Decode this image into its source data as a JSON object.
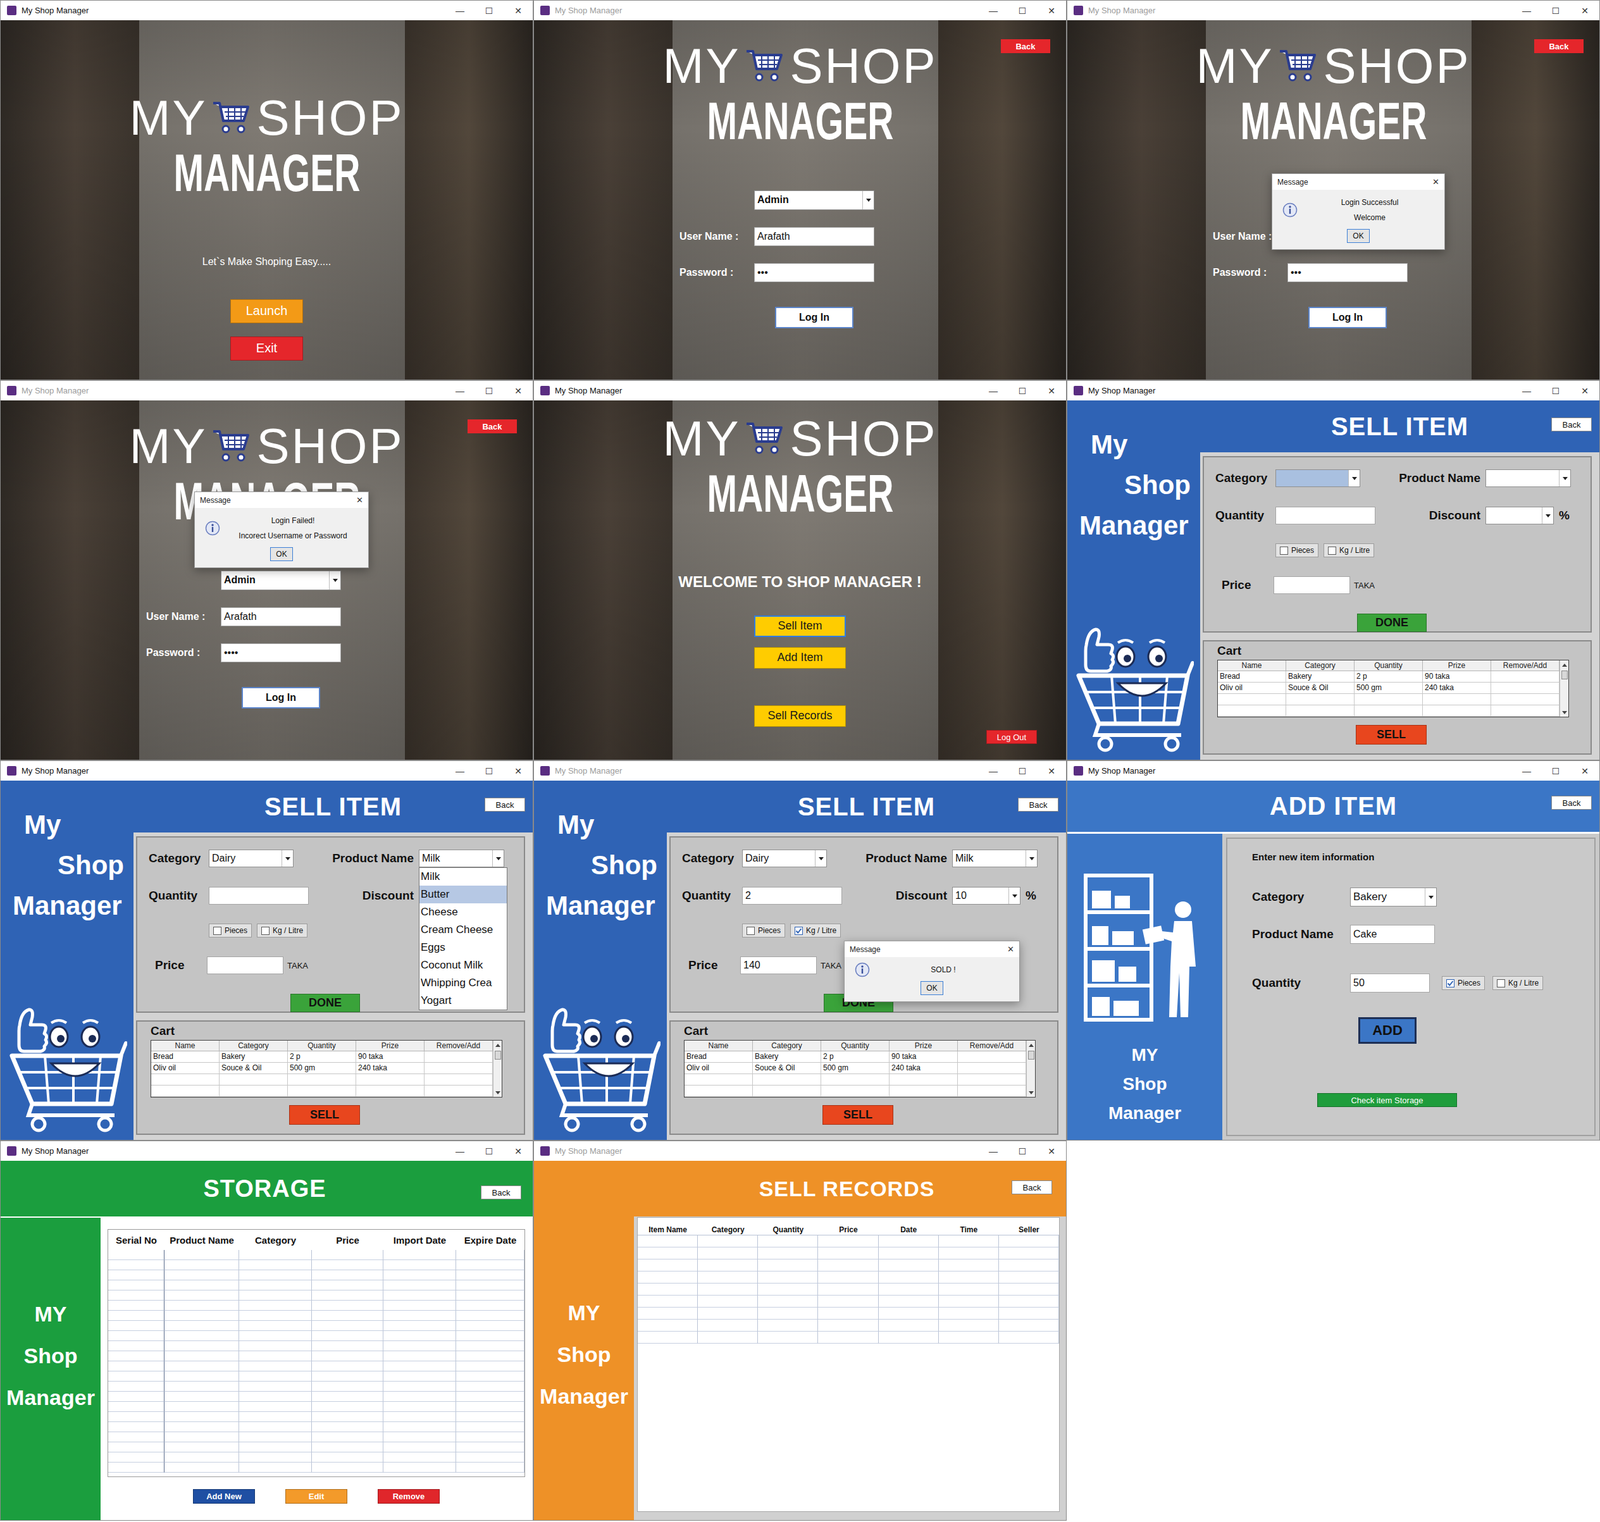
{
  "app_title": "My Shop Manager",
  "window_controls": [
    "—",
    "☐",
    "✕"
  ],
  "logo": {
    "my": "MY",
    "shop": "SHOP",
    "manager": "MANAGER"
  },
  "windows": [
    {
      "kind": "splash",
      "active": true,
      "tagline": "Let`s Make Shoping Easy.....",
      "buttons": [
        {
          "label": "Launch",
          "color": "#f39a16"
        },
        {
          "label": "Exit",
          "color": "#e5262b"
        }
      ]
    },
    {
      "kind": "login",
      "active": false,
      "back": "Back",
      "role": "Admin",
      "fields": [
        {
          "label": "User Name :",
          "value": "Arafath"
        },
        {
          "label": "Password :",
          "value": "•••"
        }
      ],
      "submit": "Log In"
    },
    {
      "kind": "login",
      "active": false,
      "back": "Back",
      "role": "Admin",
      "fields": [
        {
          "label": "User Name :",
          "value": "Arafath"
        },
        {
          "label": "Password :",
          "value": "•••"
        }
      ],
      "submit": "Log In",
      "dialog": {
        "kind": "success",
        "title": "Message",
        "close": "✕",
        "lines": [
          "Login Successful",
          "Welcome"
        ],
        "ok": "OK"
      }
    },
    {
      "kind": "login",
      "active": false,
      "back": "Back",
      "role": "Admin",
      "fields": [
        {
          "label": "User Name :",
          "value": "Arafath"
        },
        {
          "label": "Password :",
          "value": "••••"
        }
      ],
      "submit": "Log In",
      "dialog": {
        "kind": "failure",
        "title": "Message",
        "close": "✕",
        "lines": [
          "Login Failed!",
          "Incorect Username or Password"
        ],
        "ok": "OK"
      }
    },
    {
      "kind": "welcome",
      "active": true,
      "heading": "WELCOME TO SHOP MANAGER !",
      "buttons": [
        {
          "label": "Sell Item",
          "color": "#ffcc00",
          "focused": true
        },
        {
          "label": "Add Item",
          "color": "#ffcc00",
          "focused": false
        },
        {
          "label": "Sell Records",
          "color": "#ffcc00",
          "focused": false
        }
      ],
      "logout": {
        "label": "Log Out",
        "color": "#e5262b"
      }
    },
    {
      "kind": "sell",
      "active": true,
      "title": "SELL ITEM",
      "back": "Back",
      "sidebar": [
        "My",
        "Shop",
        "Manager"
      ],
      "form": {
        "category": {
          "label": "Category",
          "value": "",
          "focused": true
        },
        "product": {
          "label": "Product Name",
          "value": ""
        },
        "quantity": {
          "label": "Quantity",
          "value": ""
        },
        "discount": {
          "label": "Discount",
          "value": "",
          "unit": "%"
        },
        "units": [
          {
            "label": "Pieces",
            "checked": false
          },
          {
            "label": "Kg / Litre",
            "checked": false
          }
        ],
        "price": {
          "label": "Price",
          "value": "",
          "unit": "TAKA"
        },
        "done": "DONE"
      },
      "cart": {
        "label": "Cart",
        "columns": [
          "Name",
          "Category",
          "Quantity",
          "Prize",
          "Remove/Add"
        ],
        "rows": [
          [
            "Bread",
            "Bakery",
            "2 p",
            "90 taka",
            ""
          ],
          [
            "Oliv oil",
            "Souce & Oil",
            "500 gm",
            "240 taka",
            ""
          ]
        ]
      },
      "sell": "SELL"
    },
    {
      "kind": "sell",
      "active": true,
      "title": "SELL ITEM",
      "back": "Back",
      "sidebar": [
        "My",
        "Shop",
        "Manager"
      ],
      "form": {
        "category": {
          "label": "Category",
          "value": "Dairy",
          "focused": false
        },
        "product": {
          "label": "Product Name",
          "value": "Milk",
          "options": [
            {
              "label": "Milk",
              "selected": false
            },
            {
              "label": "Butter",
              "selected": true
            },
            {
              "label": "Cheese",
              "selected": false
            },
            {
              "label": "Cream Cheese",
              "selected": false
            },
            {
              "label": "Eggs",
              "selected": false
            },
            {
              "label": "Coconut Milk",
              "selected": false
            },
            {
              "label": "Whipping Crea",
              "selected": false
            },
            {
              "label": "Yogart",
              "selected": false
            }
          ]
        },
        "quantity": {
          "label": "Quantity",
          "value": ""
        },
        "discount": {
          "label": "Discount",
          "value": "",
          "unit": "%"
        },
        "units": [
          {
            "label": "Pieces",
            "checked": false
          },
          {
            "label": "Kg / Litre",
            "checked": false
          }
        ],
        "price": {
          "label": "Price",
          "value": "",
          "unit": "TAKA"
        },
        "done": "DONE"
      },
      "cart": {
        "label": "Cart",
        "columns": [
          "Name",
          "Category",
          "Quantity",
          "Prize",
          "Remove/Add"
        ],
        "rows": [
          [
            "Bread",
            "Bakery",
            "2 p",
            "90 taka",
            ""
          ],
          [
            "Oliv oil",
            "Souce & Oil",
            "500 gm",
            "240 taka",
            ""
          ]
        ]
      },
      "sell": "SELL"
    },
    {
      "kind": "sell",
      "active": false,
      "title": "SELL ITEM",
      "back": "Back",
      "sidebar": [
        "My",
        "Shop",
        "Manager"
      ],
      "form": {
        "category": {
          "label": "Category",
          "value": "Dairy",
          "focused": false
        },
        "product": {
          "label": "Product Name",
          "value": "Milk"
        },
        "quantity": {
          "label": "Quantity",
          "value": "2"
        },
        "discount": {
          "label": "Discount",
          "value": "10",
          "unit": "%"
        },
        "units": [
          {
            "label": "Pieces",
            "checked": false
          },
          {
            "label": "Kg / Litre",
            "checked": true
          }
        ],
        "price": {
          "label": "Price",
          "value": "140",
          "unit": "TAKA"
        },
        "done": "DONE"
      },
      "cart": {
        "label": "Cart",
        "columns": [
          "Name",
          "Category",
          "Quantity",
          "Prize",
          "Remove/Add"
        ],
        "rows": [
          [
            "Bread",
            "Bakery",
            "2 p",
            "90 taka",
            ""
          ],
          [
            "Oliv oil",
            "Souce & Oil",
            "500 gm",
            "240 taka",
            ""
          ]
        ]
      },
      "sell": "SELL",
      "dialog": {
        "kind": "sold",
        "title": "Message",
        "close": "✕",
        "lines": [
          "SOLD !"
        ],
        "ok": "OK"
      }
    },
    {
      "kind": "add",
      "active": true,
      "title": "ADD ITEM",
      "back": "Back",
      "sidebar": [
        "MY",
        "Shop",
        "Manager"
      ],
      "intro": "Enter new item information",
      "category": {
        "label": "Category",
        "value": "Bakery"
      },
      "product": {
        "label": "Product Name",
        "value": "Cake"
      },
      "quantity": {
        "label": "Quantity",
        "value": "50"
      },
      "units": [
        {
          "label": "Pieces",
          "checked": true
        },
        {
          "label": "Kg / Litre",
          "checked": false
        }
      ],
      "add": "ADD",
      "storage_link": "Check item Storage"
    },
    {
      "kind": "storage",
      "active": true,
      "title": "STORAGE",
      "back": "Back",
      "sidebar": [
        "MY",
        "Shop",
        "Manager"
      ],
      "columns": [
        "Serial No",
        "Product Name",
        "Category",
        "Price",
        "Import Date",
        "Expire Date"
      ],
      "actions": [
        {
          "label": "Add New",
          "color": "#1f4fa3"
        },
        {
          "label": "Edit",
          "color": "#f39a2a"
        },
        {
          "label": "Remove",
          "color": "#e0262b"
        }
      ]
    },
    {
      "kind": "records",
      "active": false,
      "title": "SELL RECORDS",
      "back": "Back",
      "sidebar": [
        "MY",
        "Shop",
        "Manager"
      ],
      "columns": [
        "Item Name",
        "Category",
        "Quantity",
        "Price",
        "Date",
        "Time",
        "Seller"
      ]
    }
  ]
}
